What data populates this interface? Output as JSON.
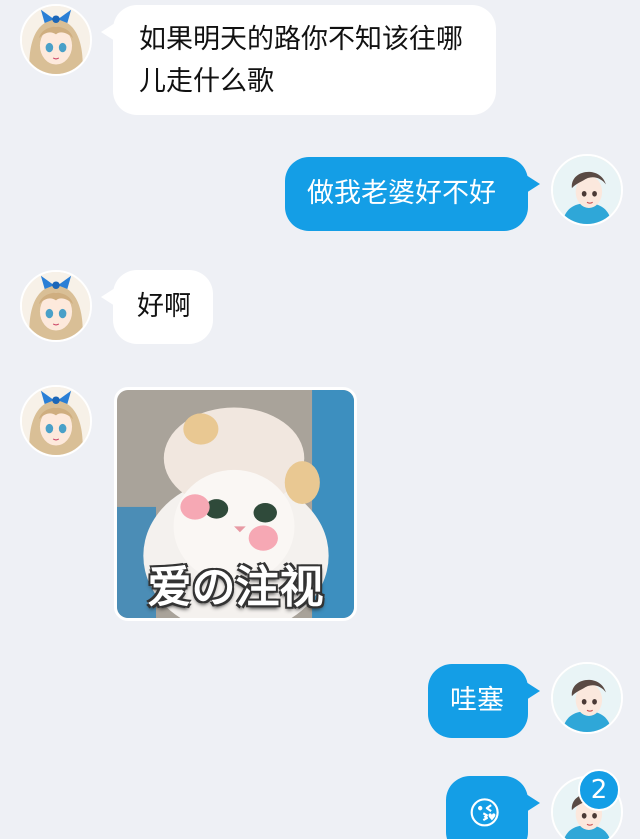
{
  "messages": [
    {
      "from": "friend",
      "text": "如果明天的路你不知该往哪儿走什么歌"
    },
    {
      "from": "me",
      "text": "做我老婆好不好"
    },
    {
      "from": "friend",
      "text": "好啊"
    },
    {
      "from": "friend",
      "type": "sticker",
      "caption": "爱の注视"
    },
    {
      "from": "me",
      "text": "哇塞"
    },
    {
      "from": "me",
      "type": "emoji",
      "emoji": "😘"
    }
  ],
  "avatars": {
    "friend": "anime-girl-avatar",
    "me": "anime-boy-avatar"
  },
  "unread_badge": "2",
  "colors": {
    "background": "#eef0f5",
    "outgoing_bubble": "#149ee6",
    "incoming_bubble": "#ffffff"
  }
}
